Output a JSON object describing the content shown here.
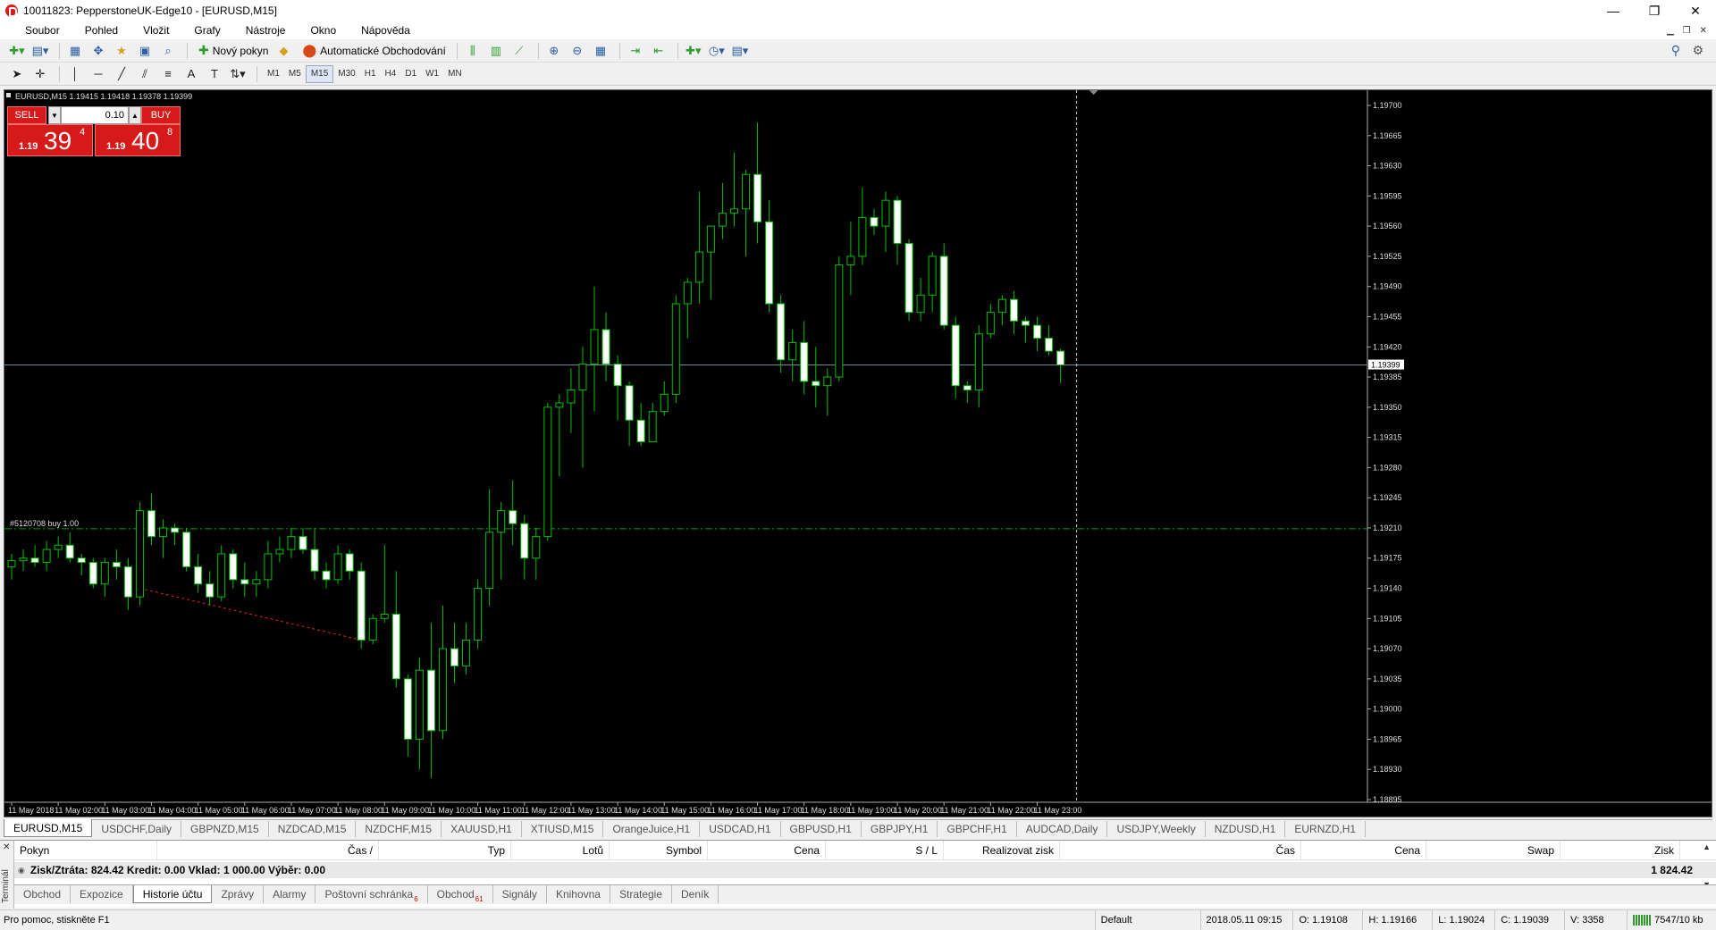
{
  "window": {
    "title": "10011823: PepperstoneUK-Edge10 - [EURUSD,M15]",
    "minimize": "—",
    "restore": "❐",
    "close": "✕"
  },
  "menu": [
    "Soubor",
    "Pohled",
    "Vložit",
    "Grafy",
    "Nástroje",
    "Okno",
    "Nápověda"
  ],
  "toolbar": {
    "new_order": "Nový pokyn",
    "auto_trading": "Automatické Obchodování"
  },
  "timeframes": [
    "M1",
    "M5",
    "M15",
    "M30",
    "H1",
    "H4",
    "D1",
    "W1",
    "MN"
  ],
  "active_timeframe": "M15",
  "chart": {
    "header": "EURUSD,M15  1.19415 1.19418 1.19378 1.19399",
    "order_label": "#5120708 buy 1.00",
    "current_price": "1.19399",
    "price_labels": [
      "1.19700",
      "1.19665",
      "1.19630",
      "1.19595",
      "1.19560",
      "1.19525",
      "1.19490",
      "1.19455",
      "1.19420",
      "1.19385",
      "1.19350",
      "1.19315",
      "1.19280",
      "1.19245",
      "1.19210",
      "1.19175",
      "1.19140",
      "1.19105",
      "1.19070",
      "1.19035",
      "1.19000",
      "1.18965",
      "1.18930",
      "1.18895"
    ],
    "time_labels": [
      "11 May 2018",
      "11 May 02:00",
      "11 May 03:00",
      "11 May 04:00",
      "11 May 05:00",
      "11 May 06:00",
      "11 May 07:00",
      "11 May 08:00",
      "11 May 09:00",
      "11 May 10:00",
      "11 May 11:00",
      "11 May 12:00",
      "11 May 13:00",
      "11 May 14:00",
      "11 May 15:00",
      "11 May 16:00",
      "11 May 17:00",
      "11 May 18:00",
      "11 May 19:00",
      "11 May 20:00",
      "11 May 21:00",
      "11 May 22:00",
      "11 May 23:00"
    ],
    "colors": {
      "bull": "#000000",
      "bear": "#ffffff",
      "wick": "#00c000",
      "order": "#00a000",
      "bid": "#6d8a9e"
    }
  },
  "chart_data": {
    "type": "candlestick",
    "symbol": "EURUSD",
    "timeframe": "M15",
    "ylim": [
      1.18895,
      1.197
    ],
    "order_price": 1.19209,
    "bid": 1.19399,
    "candles": [
      [
        1.19165,
        1.1918,
        1.1915,
        1.19172
      ],
      [
        1.19172,
        1.19185,
        1.1916,
        1.19175
      ],
      [
        1.19175,
        1.1919,
        1.19165,
        1.1917
      ],
      [
        1.1917,
        1.19195,
        1.1916,
        1.19185
      ],
      [
        1.19185,
        1.192,
        1.19175,
        1.1919
      ],
      [
        1.1919,
        1.19205,
        1.1917,
        1.19175
      ],
      [
        1.19175,
        1.1918,
        1.19155,
        1.1917
      ],
      [
        1.1917,
        1.19175,
        1.1914,
        1.19145
      ],
      [
        1.19145,
        1.19175,
        1.1913,
        1.1917
      ],
      [
        1.1917,
        1.19185,
        1.1915,
        1.19165
      ],
      [
        1.19165,
        1.19175,
        1.19115,
        1.1913
      ],
      [
        1.1913,
        1.1924,
        1.1912,
        1.1923
      ],
      [
        1.1923,
        1.1925,
        1.1919,
        1.192
      ],
      [
        1.192,
        1.1922,
        1.19175,
        1.1921
      ],
      [
        1.1921,
        1.19215,
        1.1919,
        1.19205
      ],
      [
        1.19205,
        1.1921,
        1.1916,
        1.19165
      ],
      [
        1.19165,
        1.1918,
        1.19135,
        1.19145
      ],
      [
        1.19145,
        1.1916,
        1.1912,
        1.1913
      ],
      [
        1.1913,
        1.1919,
        1.19125,
        1.1918
      ],
      [
        1.1918,
        1.19185,
        1.1914,
        1.1915
      ],
      [
        1.1915,
        1.1917,
        1.1913,
        1.19145
      ],
      [
        1.19145,
        1.1916,
        1.1913,
        1.1915
      ],
      [
        1.1915,
        1.19195,
        1.1914,
        1.1918
      ],
      [
        1.1918,
        1.192,
        1.1917,
        1.19185
      ],
      [
        1.19185,
        1.1921,
        1.19175,
        1.192
      ],
      [
        1.192,
        1.1921,
        1.1918,
        1.19185
      ],
      [
        1.19185,
        1.1921,
        1.1915,
        1.1916
      ],
      [
        1.1916,
        1.1917,
        1.1914,
        1.1915
      ],
      [
        1.1915,
        1.1919,
        1.19145,
        1.1918
      ],
      [
        1.1918,
        1.19185,
        1.1915,
        1.1916
      ],
      [
        1.1916,
        1.1917,
        1.1907,
        1.1908
      ],
      [
        1.1908,
        1.1911,
        1.19075,
        1.19105
      ],
      [
        1.19105,
        1.1919,
        1.191,
        1.1911
      ],
      [
        1.1911,
        1.1916,
        1.19025,
        1.19035
      ],
      [
        1.19035,
        1.1904,
        1.18945,
        1.18965
      ],
      [
        1.18965,
        1.1906,
        1.1893,
        1.19045
      ],
      [
        1.19045,
        1.191,
        1.1892,
        1.18975
      ],
      [
        1.18975,
        1.1912,
        1.18965,
        1.1907
      ],
      [
        1.1907,
        1.191,
        1.1903,
        1.1905
      ],
      [
        1.1905,
        1.191,
        1.1904,
        1.1908
      ],
      [
        1.1908,
        1.1915,
        1.1907,
        1.1914
      ],
      [
        1.1914,
        1.19255,
        1.1912,
        1.19205
      ],
      [
        1.19205,
        1.1924,
        1.1915,
        1.1923
      ],
      [
        1.1923,
        1.19265,
        1.1919,
        1.19215
      ],
      [
        1.19215,
        1.19225,
        1.1915,
        1.19175
      ],
      [
        1.19175,
        1.1921,
        1.1915,
        1.192
      ],
      [
        1.192,
        1.19355,
        1.19195,
        1.1935
      ],
      [
        1.1935,
        1.19365,
        1.1927,
        1.19355
      ],
      [
        1.19355,
        1.19395,
        1.1932,
        1.1937
      ],
      [
        1.1937,
        1.1942,
        1.1928,
        1.194
      ],
      [
        1.194,
        1.1949,
        1.19345,
        1.1944
      ],
      [
        1.1944,
        1.1946,
        1.1938,
        1.194
      ],
      [
        1.194,
        1.1941,
        1.19335,
        1.19375
      ],
      [
        1.19375,
        1.1938,
        1.19305,
        1.19335
      ],
      [
        1.19335,
        1.19355,
        1.19305,
        1.1931
      ],
      [
        1.1931,
        1.19355,
        1.1931,
        1.19345
      ],
      [
        1.19345,
        1.1938,
        1.1934,
        1.19365
      ],
      [
        1.19365,
        1.1948,
        1.19355,
        1.1947
      ],
      [
        1.1947,
        1.195,
        1.1943,
        1.19495
      ],
      [
        1.19495,
        1.196,
        1.1947,
        1.1953
      ],
      [
        1.1953,
        1.1956,
        1.19475,
        1.1956
      ],
      [
        1.1956,
        1.1961,
        1.19545,
        1.19575
      ],
      [
        1.19575,
        1.19645,
        1.1956,
        1.1958
      ],
      [
        1.1958,
        1.19625,
        1.19525,
        1.1962
      ],
      [
        1.1962,
        1.1968,
        1.1954,
        1.19565
      ],
      [
        1.19565,
        1.1959,
        1.1946,
        1.1947
      ],
      [
        1.1947,
        1.1948,
        1.1939,
        1.19405
      ],
      [
        1.19405,
        1.1944,
        1.1938,
        1.19425
      ],
      [
        1.19425,
        1.1945,
        1.19365,
        1.1938
      ],
      [
        1.1938,
        1.1942,
        1.1935,
        1.19375
      ],
      [
        1.19375,
        1.19395,
        1.1934,
        1.19385
      ],
      [
        1.19385,
        1.19525,
        1.1938,
        1.19515
      ],
      [
        1.19515,
        1.19565,
        1.1948,
        1.19525
      ],
      [
        1.19525,
        1.19605,
        1.19515,
        1.1957
      ],
      [
        1.1957,
        1.1958,
        1.1955,
        1.1956
      ],
      [
        1.1956,
        1.196,
        1.1953,
        1.1959
      ],
      [
        1.1959,
        1.19595,
        1.19515,
        1.1954
      ],
      [
        1.1954,
        1.19545,
        1.1945,
        1.1946
      ],
      [
        1.1946,
        1.195,
        1.1945,
        1.1948
      ],
      [
        1.1948,
        1.1953,
        1.1946,
        1.19525
      ],
      [
        1.19525,
        1.1954,
        1.1944,
        1.19445
      ],
      [
        1.19445,
        1.19455,
        1.1936,
        1.19375
      ],
      [
        1.19375,
        1.1938,
        1.19355,
        1.1937
      ],
      [
        1.1937,
        1.19445,
        1.1935,
        1.19435
      ],
      [
        1.19435,
        1.1947,
        1.1943,
        1.1946
      ],
      [
        1.1946,
        1.1948,
        1.19445,
        1.19475
      ],
      [
        1.19475,
        1.19485,
        1.19435,
        1.1945
      ],
      [
        1.1945,
        1.19455,
        1.19425,
        1.19445
      ],
      [
        1.19445,
        1.19455,
        1.19415,
        1.1943
      ],
      [
        1.1943,
        1.19445,
        1.1941,
        1.19415
      ],
      [
        1.19415,
        1.19418,
        1.19378,
        1.19399
      ]
    ]
  },
  "trade_panel": {
    "sell": "SELL",
    "buy": "BUY",
    "lot": "0.10",
    "sell_small": "1.19",
    "sell_big": "39",
    "sell_sup": "4",
    "buy_small": "1.19",
    "buy_big": "40",
    "buy_sup": "8"
  },
  "symbol_tabs": [
    "EURUSD,M15",
    "USDCHF,Daily",
    "GBPNZD,M15",
    "NZDCAD,M15",
    "NZDCHF,M15",
    "XAUUSD,H1",
    "XTIUSD,M15",
    "OrangeJuice,H1",
    "USDCAD,H1",
    "GBPUSD,H1",
    "GBPJPY,H1",
    "GBPCHF,H1",
    "AUDCAD,Daily",
    "USDJPY,Weekly",
    "NZDUSD,H1",
    "EURNZD,H1"
  ],
  "terminal": {
    "side_label": "Terminál",
    "columns": [
      {
        "label": "Pokyn",
        "w": 160
      },
      {
        "label": "Čas  /",
        "w": 248
      },
      {
        "label": "Typ",
        "w": 148
      },
      {
        "label": "Lotů",
        "w": 110
      },
      {
        "label": "Symbol",
        "w": 110
      },
      {
        "label": "Cena",
        "w": 132
      },
      {
        "label": "S / L",
        "w": 132
      },
      {
        "label": "Realizovat zisk",
        "w": 130
      },
      {
        "label": "Čas",
        "w": 270
      },
      {
        "label": "Cena",
        "w": 140
      },
      {
        "label": "Swap",
        "w": 150
      },
      {
        "label": "Zisk",
        "w": 134
      }
    ],
    "summary": "Zisk/Ztráta: 824.42  Kredit: 0.00  Vklad: 1 000.00  Výběr: 0.00",
    "total": "1 824.42"
  },
  "terminal_tabs": [
    {
      "label": "Obchod",
      "badge": ""
    },
    {
      "label": "Expozice",
      "badge": ""
    },
    {
      "label": "Historie účtu",
      "badge": ""
    },
    {
      "label": "Zprávy",
      "badge": ""
    },
    {
      "label": "Alarmy",
      "badge": ""
    },
    {
      "label": "Poštovní schránka",
      "badge": "6"
    },
    {
      "label": "Obchod",
      "badge": "61"
    },
    {
      "label": "Signály",
      "badge": ""
    },
    {
      "label": "Knihovna",
      "badge": ""
    },
    {
      "label": "Strategie",
      "badge": ""
    },
    {
      "label": "Deník",
      "badge": ""
    }
  ],
  "active_terminal_tab": 2,
  "status": {
    "help": "Pro pomoc, stiskněte F1",
    "profile": "Default",
    "datetime": "2018.05.11 09:15",
    "open": "O: 1.19108",
    "high": "H: 1.19166",
    "low": "L: 1.19024",
    "close": "C: 1.19039",
    "volume": "V: 3358",
    "traffic": "7547/10 kb"
  }
}
